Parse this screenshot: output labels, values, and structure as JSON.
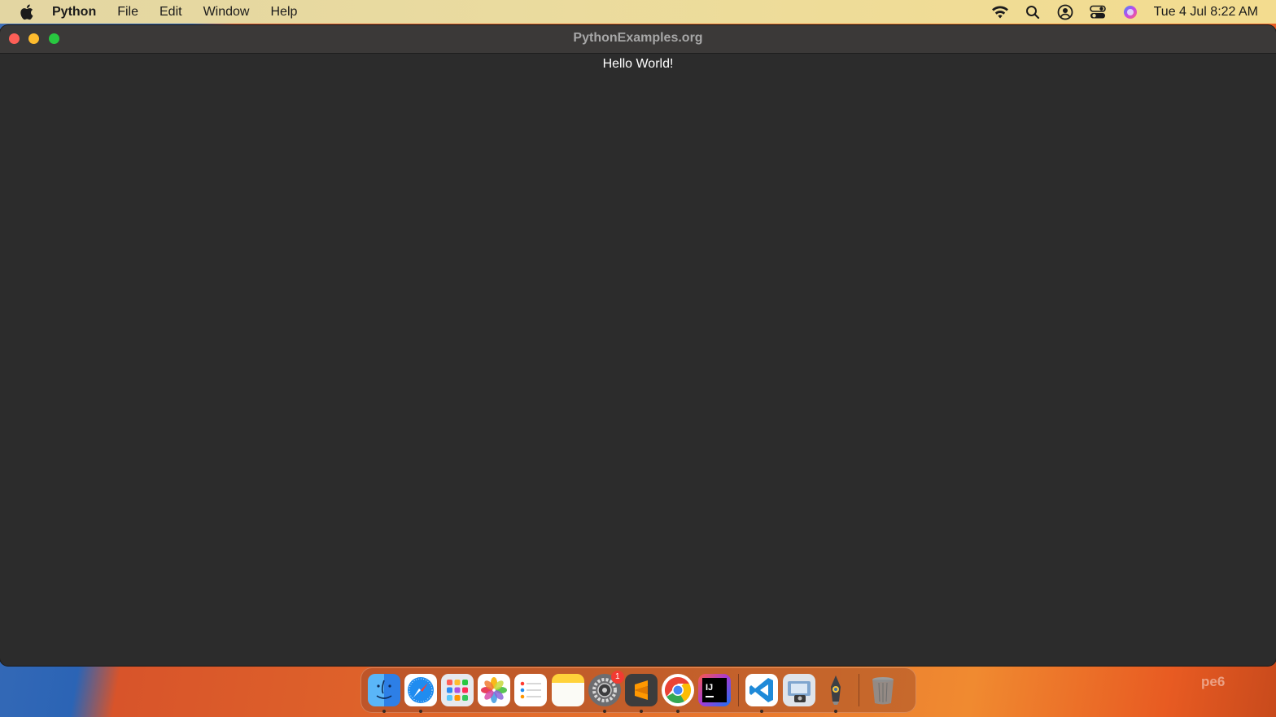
{
  "menubar": {
    "app_name": "Python",
    "menus": [
      "File",
      "Edit",
      "Window",
      "Help"
    ],
    "status_icons": [
      "wifi-icon",
      "search-icon",
      "user-account-icon",
      "control-center-icon",
      "siri-icon"
    ],
    "clock": "Tue 4 Jul  8:22 AM"
  },
  "window": {
    "title": "PythonExamples.org",
    "label_text": "Hello World!"
  },
  "dock": {
    "apps": [
      {
        "name": "finder-icon",
        "running": true
      },
      {
        "name": "safari-icon",
        "running": true
      },
      {
        "name": "launchpad-icon",
        "running": false
      },
      {
        "name": "photos-icon",
        "running": false
      },
      {
        "name": "reminders-icon",
        "running": false
      },
      {
        "name": "notes-icon",
        "running": false
      },
      {
        "name": "system-settings-icon",
        "running": true,
        "badge": "1"
      },
      {
        "name": "sublime-text-icon",
        "running": true
      },
      {
        "name": "chrome-icon",
        "running": true
      },
      {
        "name": "intellij-icon",
        "running": false
      },
      {
        "name": "vscode-icon",
        "running": true
      },
      {
        "name": "preview-icon",
        "running": false
      },
      {
        "name": "python-launcher-icon",
        "running": true
      },
      {
        "name": "trash-icon",
        "running": false
      }
    ]
  },
  "watermark": "pe6",
  "colors": {
    "close": "#fe5f57",
    "minimize": "#febc2e",
    "maximize": "#28c840",
    "window_bg": "#2c2c2c",
    "titlebar_bg": "#3b3938"
  }
}
